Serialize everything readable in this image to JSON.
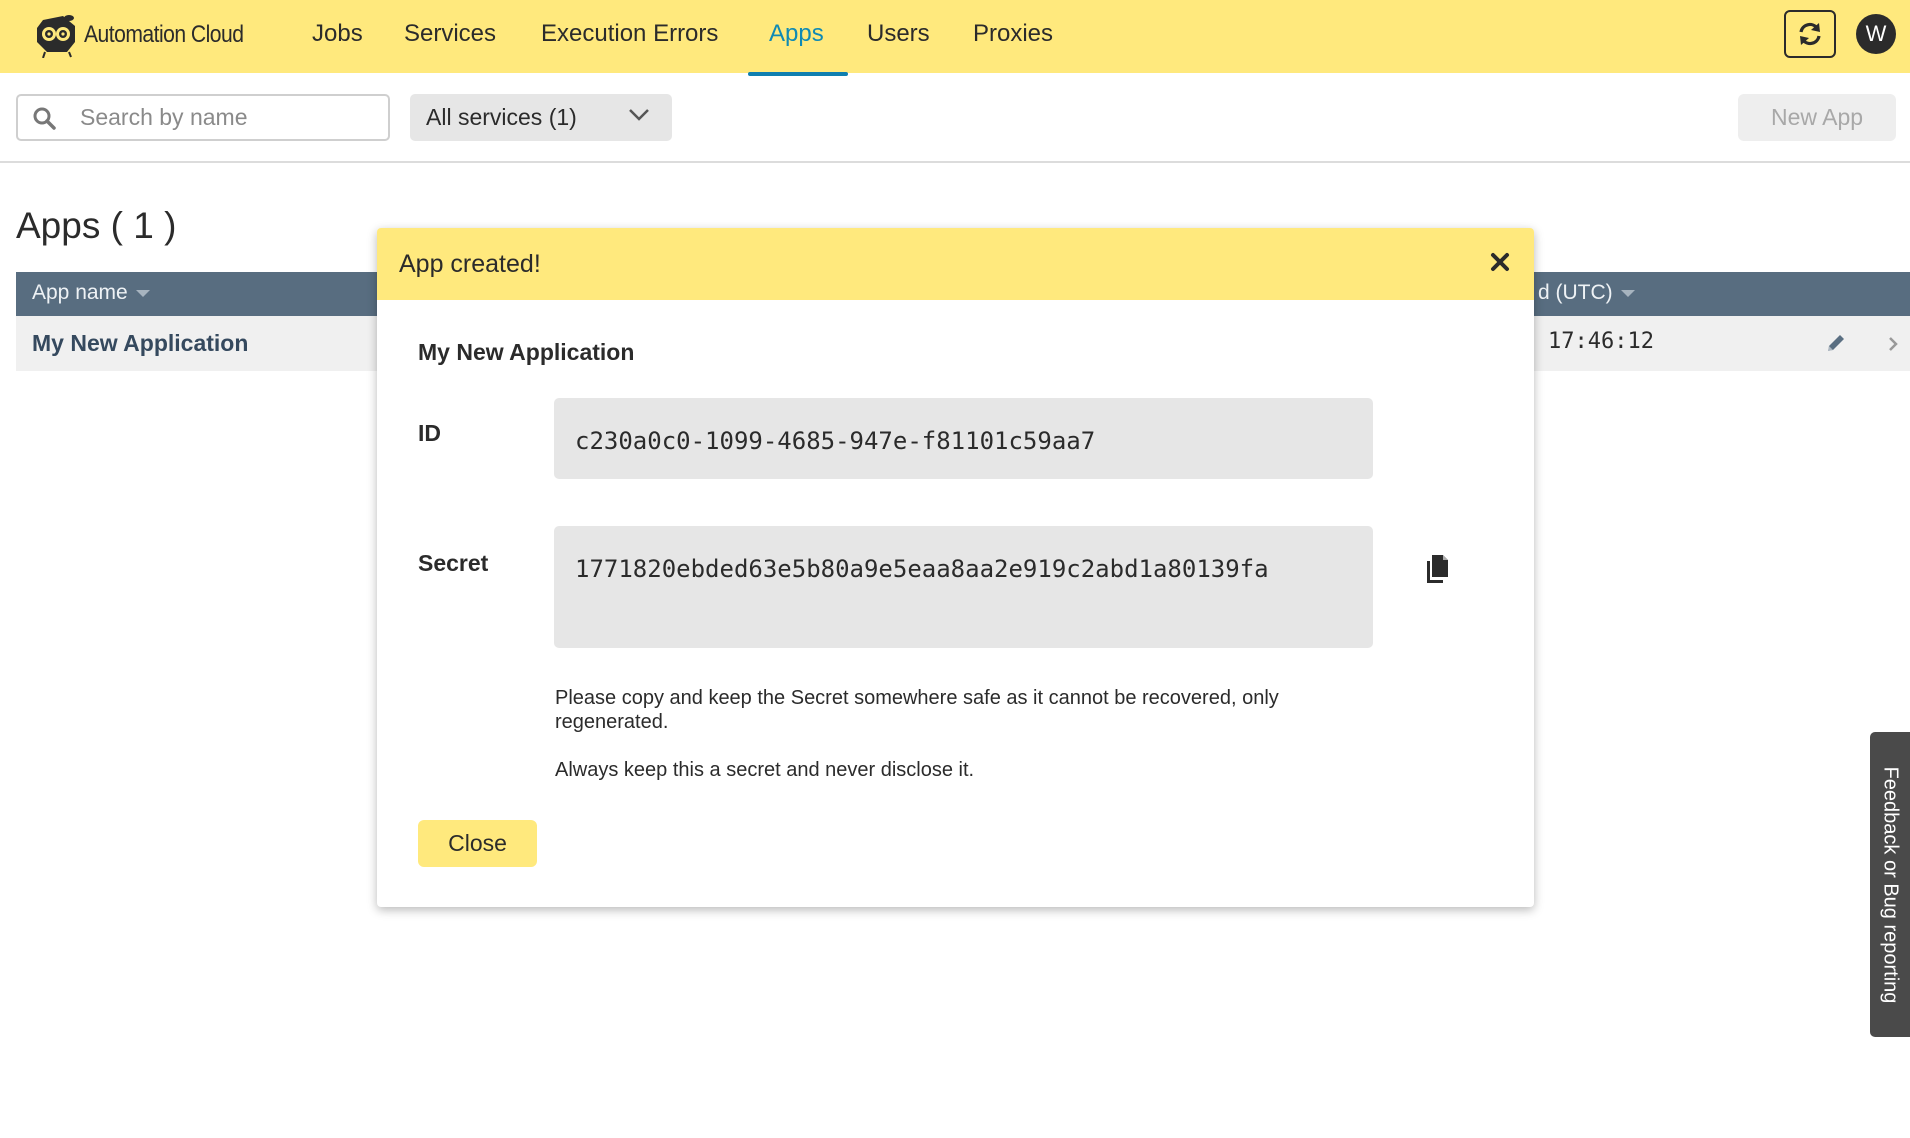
{
  "app": {
    "brand": "Automation Cloud",
    "accent_color": "#ffe97d",
    "active_color": "#0f8ab4"
  },
  "nav": {
    "items": [
      {
        "label": "Jobs",
        "active": false
      },
      {
        "label": "Services",
        "active": false
      },
      {
        "label": "Execution Errors",
        "active": false
      },
      {
        "label": "Apps",
        "active": true
      },
      {
        "label": "Users",
        "active": false
      },
      {
        "label": "Proxies",
        "active": false
      }
    ],
    "refresh_icon": "refresh-icon",
    "avatar_initial": "W"
  },
  "toolbar": {
    "search_placeholder": "Search by name",
    "search_value": "",
    "services_filter": "All services (1)",
    "new_app_label": "New App"
  },
  "page": {
    "title": "Apps ( 1 )"
  },
  "table": {
    "columns": [
      {
        "label": "App name"
      },
      {
        "label": "d (UTC)"
      }
    ],
    "rows": [
      {
        "name": "My New Application",
        "time": "17:46:12"
      }
    ]
  },
  "modal": {
    "title": "App created!",
    "app_name": "My New Application",
    "id_label": "ID",
    "id_value": "c230a0c0-1099-4685-947e-f81101c59aa7",
    "secret_label": "Secret",
    "secret_value": "1771820ebded63e5b80a9e5eaa8aa2e919c2abd1a80139fa",
    "note1": "Please copy and keep the Secret somewhere safe as it cannot be recovered, only regenerated.",
    "note2": "Always keep this a secret and never disclose it.",
    "close_label": "Close"
  },
  "feedback": {
    "label": "Feedback or Bug reporting"
  }
}
